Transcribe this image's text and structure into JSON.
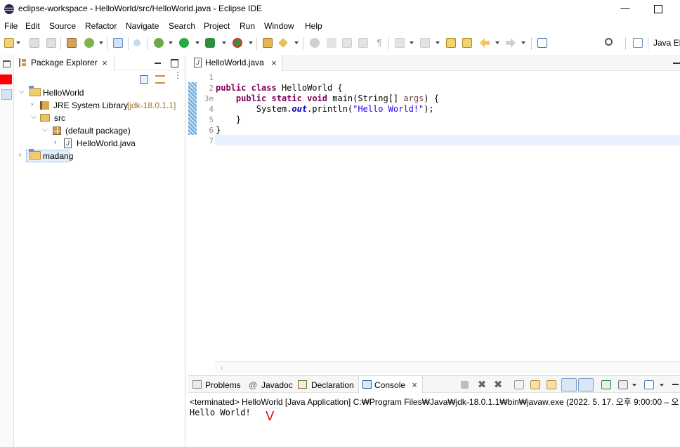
{
  "window": {
    "title": "eclipse-workspace - HelloWorld/src/HelloWorld.java - Eclipse IDE",
    "minimize_glyph": "—"
  },
  "menu": [
    "File",
    "Edit",
    "Source",
    "Refactor",
    "Navigate",
    "Search",
    "Project",
    "Run",
    "Window",
    "Help"
  ],
  "toolbar": {
    "perspective_label": "Java EE"
  },
  "package_explorer": {
    "tab_label": "Package Explorer",
    "tree": {
      "project": "HelloWorld",
      "jre_label": "JRE System Library",
      "jre_version": "[jdk-18.0.1.1]",
      "src": "src",
      "default_package": "(default package)",
      "file": "HelloWorld.java",
      "project2": "madang"
    }
  },
  "editor": {
    "tab_label": "HelloWorld.java",
    "line_numbers": [
      "1",
      "2",
      "3⊖",
      "4",
      "5",
      "6",
      "7"
    ],
    "code": {
      "line2": {
        "kw1": "public",
        "kw2": "class",
        "rest": " HelloWorld {"
      },
      "line3": {
        "indent": "    ",
        "kw1": "public",
        "kw2": "static",
        "kw3": "void",
        "mid": " main(String[] ",
        "param": "args",
        "end": ") {"
      },
      "line4": {
        "indent": "        ",
        "pre": "System.",
        "field": "out",
        "mid": ".println(",
        "str": "\"Hello World!\"",
        "end": ");"
      },
      "line5": "    }",
      "line6": "}"
    }
  },
  "bottom_panel": {
    "tabs": {
      "problems": "Problems",
      "javadoc": "Javadoc",
      "declaration": "Declaration",
      "console": "Console"
    },
    "console_status": "<terminated> HelloWorld [Java Application] C:₩Program Files₩Java₩jdk-18.0.1.1₩bin₩javaw.exe  (2022. 5. 17. 오후 9:00:00 – 오",
    "console_output": "Hello World!",
    "annotation": "V"
  },
  "colors": {
    "keyword": "#7f0055",
    "string": "#2a00ff",
    "field": "#0000c0",
    "current_line": "#e8f2fe",
    "annotation": "#e01010"
  }
}
